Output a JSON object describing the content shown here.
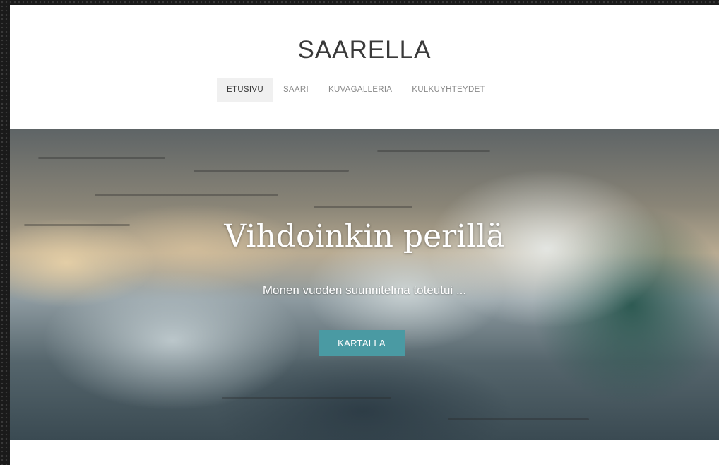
{
  "site": {
    "title": "SAARELLA"
  },
  "nav": {
    "items": [
      {
        "label": "ETUSIVU",
        "active": true
      },
      {
        "label": "SAARI",
        "active": false
      },
      {
        "label": "KUVAGALLERIA",
        "active": false
      },
      {
        "label": "KULKUYHTEYDET",
        "active": false
      }
    ]
  },
  "hero": {
    "title": "Vihdoinkin perillä",
    "subtitle": "Monen vuoden suunnitelma toteutui ...",
    "button_label": "KARTALLA",
    "button_color": "#4a9aa3"
  },
  "colors": {
    "frame": "#1a1a1a",
    "page_background": "#ffffff",
    "title_text": "#3a3a3a",
    "nav_text": "#8a8a8a",
    "nav_active_background": "#f0f0f0"
  }
}
